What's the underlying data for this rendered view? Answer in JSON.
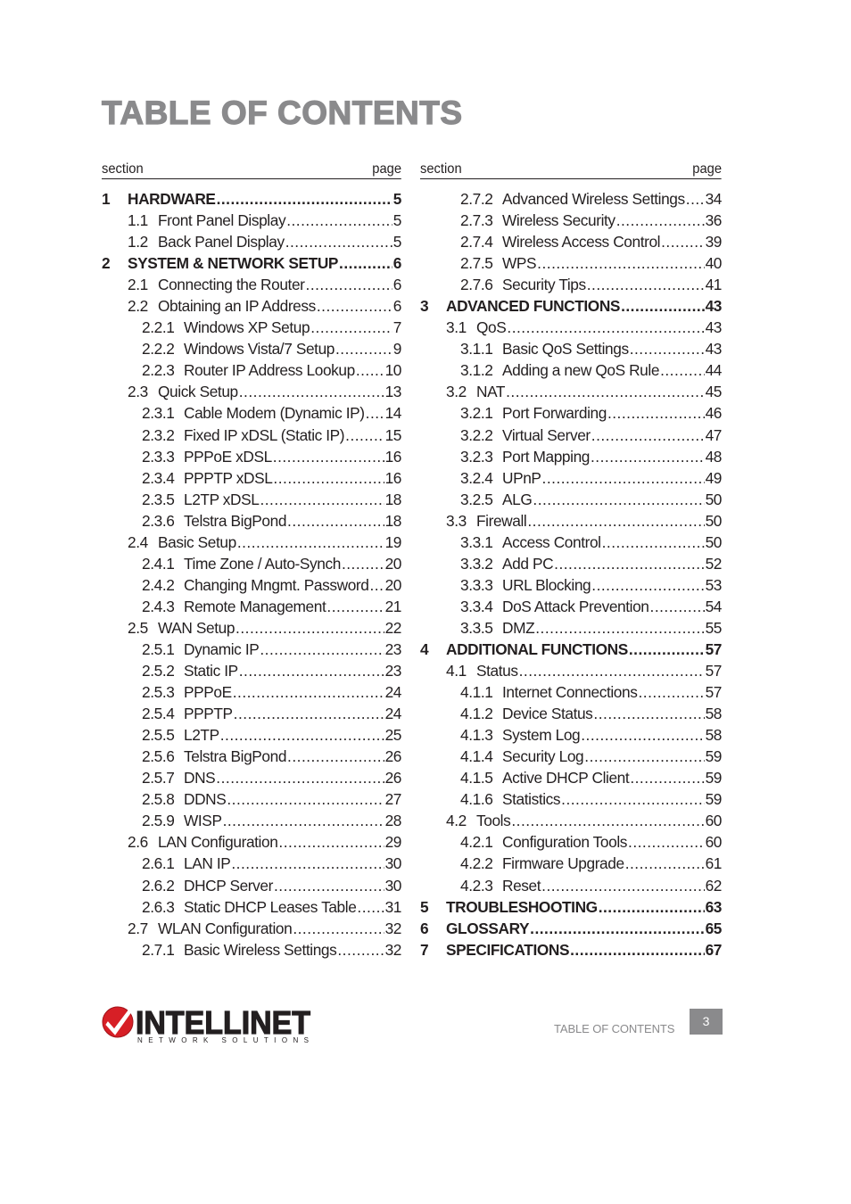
{
  "title": "TABLE OF CONTENTS",
  "columns": [
    {
      "header": {
        "section": "section",
        "page": "page"
      },
      "entries": [
        {
          "level": 1,
          "num": "1",
          "label": "HARDWARE",
          "page": "5"
        },
        {
          "level": 2,
          "num": "1.1",
          "label": "Front Panel Display",
          "page": "5"
        },
        {
          "level": 2,
          "num": "1.2",
          "label": "Back Panel Display",
          "page": "5"
        },
        {
          "level": 1,
          "num": "2",
          "label": "SYSTEM & NETWORK SETUP",
          "page": "6"
        },
        {
          "level": 2,
          "num": "2.1",
          "label": "Connecting the Router",
          "page": "6"
        },
        {
          "level": 2,
          "num": "2.2",
          "label": "Obtaining an IP Address",
          "page": "6"
        },
        {
          "level": 3,
          "num": "2.2.1",
          "label": "Windows XP Setup",
          "page": "7"
        },
        {
          "level": 3,
          "num": "2.2.2",
          "label": "Windows Vista/7 Setup",
          "page": "9"
        },
        {
          "level": 3,
          "num": "2.2.3",
          "label": "Router IP Address Lookup",
          "page": "10"
        },
        {
          "level": 2,
          "num": "2.3",
          "label": "Quick Setup",
          "page": "13"
        },
        {
          "level": 3,
          "num": "2.3.1",
          "label": "Cable Modem (Dynamic IP)",
          "page": "14"
        },
        {
          "level": 3,
          "num": "2.3.2",
          "label": "Fixed IP xDSL (Static IP)",
          "page": "15"
        },
        {
          "level": 3,
          "num": "2.3.3",
          "label": "PPPoE xDSL",
          "page": "16"
        },
        {
          "level": 3,
          "num": "2.3.4",
          "label": "PPPTP xDSL",
          "page": "16"
        },
        {
          "level": 3,
          "num": "2.3.5",
          "label": "L2TP xDSL",
          "page": "18"
        },
        {
          "level": 3,
          "num": "2.3.6",
          "label": "Telstra BigPond",
          "page": "18"
        },
        {
          "level": 2,
          "num": "2.4",
          "label": "Basic Setup",
          "page": "19"
        },
        {
          "level": 3,
          "num": "2.4.1",
          "label": "Time Zone / Auto-Synch",
          "page": "20"
        },
        {
          "level": 3,
          "num": "2.4.2",
          "label": "Changing Mngmt. Password",
          "page": "20"
        },
        {
          "level": 3,
          "num": "2.4.3",
          "label": "Remote Management",
          "page": "21"
        },
        {
          "level": 2,
          "num": "2.5",
          "label": "WAN Setup",
          "page": "22"
        },
        {
          "level": 3,
          "num": "2.5.1",
          "label": "Dynamic IP",
          "page": "23"
        },
        {
          "level": 3,
          "num": "2.5.2",
          "label": "Static IP",
          "page": "23"
        },
        {
          "level": 3,
          "num": "2.5.3",
          "label": "PPPoE",
          "page": "24"
        },
        {
          "level": 3,
          "num": "2.5.4",
          "label": "PPPTP",
          "page": "24"
        },
        {
          "level": 3,
          "num": "2.5.5",
          "label": "L2TP",
          "page": "25"
        },
        {
          "level": 3,
          "num": "2.5.6",
          "label": "Telstra BigPond",
          "page": "26"
        },
        {
          "level": 3,
          "num": "2.5.7",
          "label": "DNS",
          "page": "26"
        },
        {
          "level": 3,
          "num": "2.5.8",
          "label": "DDNS",
          "page": "27"
        },
        {
          "level": 3,
          "num": "2.5.9",
          "label": "WISP",
          "page": "28"
        },
        {
          "level": 2,
          "num": "2.6",
          "label": "LAN Configuration",
          "page": "29"
        },
        {
          "level": 3,
          "num": "2.6.1",
          "label": "LAN IP",
          "page": "30"
        },
        {
          "level": 3,
          "num": "2.6.2",
          "label": "DHCP Server",
          "page": "30"
        },
        {
          "level": 3,
          "num": "2.6.3",
          "label": "Static DHCP Leases Table",
          "page": "31"
        },
        {
          "level": 2,
          "num": "2.7",
          "label": "WLAN Configuration",
          "page": "32"
        },
        {
          "level": 3,
          "num": "2.7.1",
          "label": "Basic Wireless Settings",
          "page": "32"
        }
      ]
    },
    {
      "header": {
        "section": "section",
        "page": "page"
      },
      "entries": [
        {
          "level": 3,
          "num": "2.7.2",
          "label": "Advanced Wireless Settings",
          "page": "34"
        },
        {
          "level": 3,
          "num": "2.7.3",
          "label": "Wireless Security",
          "page": "36"
        },
        {
          "level": 3,
          "num": "2.7.4",
          "label": "Wireless Access Control",
          "page": "39"
        },
        {
          "level": 3,
          "num": "2.7.5",
          "label": "WPS",
          "page": "40"
        },
        {
          "level": 3,
          "num": "2.7.6",
          "label": "Security Tips",
          "page": "41"
        },
        {
          "level": 1,
          "num": "3",
          "label": "ADVANCED FUNCTIONS",
          "page": "43"
        },
        {
          "level": 2,
          "num": "3.1",
          "label": "QoS",
          "page": "43"
        },
        {
          "level": 3,
          "num": "3.1.1",
          "label": "Basic QoS Settings",
          "page": "43"
        },
        {
          "level": 3,
          "num": "3.1.2",
          "label": "Adding a new QoS Rule",
          "page": "44"
        },
        {
          "level": 2,
          "num": "3.2",
          "label": "NAT",
          "page": "45"
        },
        {
          "level": 3,
          "num": "3.2.1",
          "label": "Port Forwarding",
          "page": "46"
        },
        {
          "level": 3,
          "num": "3.2.2",
          "label": "Virtual Server",
          "page": "47"
        },
        {
          "level": 3,
          "num": "3.2.3",
          "label": "Port Mapping",
          "page": "48"
        },
        {
          "level": 3,
          "num": "3.2.4",
          "label": "UPnP",
          "page": "49"
        },
        {
          "level": 3,
          "num": "3.2.5",
          "label": "ALG",
          "page": "50"
        },
        {
          "level": 2,
          "num": "3.3",
          "label": "Firewall",
          "page": "50"
        },
        {
          "level": 3,
          "num": "3.3.1",
          "label": "Access Control",
          "page": "50"
        },
        {
          "level": 3,
          "num": "3.3.2",
          "label": "Add PC",
          "page": "52"
        },
        {
          "level": 3,
          "num": "3.3.3",
          "label": "URL Blocking",
          "page": "53"
        },
        {
          "level": 3,
          "num": "3.3.4",
          "label": "DoS Attack Prevention",
          "page": "54"
        },
        {
          "level": 3,
          "num": "3.3.5",
          "label": "DMZ",
          "page": "55"
        },
        {
          "level": 1,
          "num": "4",
          "label": "ADDITIONAL FUNCTIONS",
          "page": "57"
        },
        {
          "level": 2,
          "num": "4.1",
          "label": "Status",
          "page": "57"
        },
        {
          "level": 3,
          "num": "4.1.1",
          "label": "Internet Connections",
          "page": "57"
        },
        {
          "level": 3,
          "num": "4.1.2",
          "label": "Device Status",
          "page": "58"
        },
        {
          "level": 3,
          "num": "4.1.3",
          "label": "System Log",
          "page": "58"
        },
        {
          "level": 3,
          "num": "4.1.4",
          "label": "Security Log",
          "page": "59"
        },
        {
          "level": 3,
          "num": "4.1.5",
          "label": "Active DHCP Client",
          "page": "59"
        },
        {
          "level": 3,
          "num": "4.1.6",
          "label": "Statistics",
          "page": "59"
        },
        {
          "level": 2,
          "num": "4.2",
          "label": "Tools",
          "page": "60"
        },
        {
          "level": 3,
          "num": "4.2.1",
          "label": "Configuration Tools",
          "page": "60"
        },
        {
          "level": 3,
          "num": "4.2.2",
          "label": "Firmware Upgrade",
          "page": "61"
        },
        {
          "level": 3,
          "num": "4.2.3",
          "label": "Reset",
          "page": "62"
        },
        {
          "level": 1,
          "num": "5",
          "label": "TROUBLESHOOTING",
          "page": "63"
        },
        {
          "level": 1,
          "num": "6",
          "label": "GLOSSARY",
          "page": "65"
        },
        {
          "level": 1,
          "num": "7",
          "label": "SPECIFICATIONS",
          "page": "67"
        }
      ]
    }
  ],
  "footer": {
    "logo": {
      "brand": "INTELLINET",
      "tagline": "NETWORK SOLUTIONS",
      "icon": "checkmark-circle-icon",
      "accent": "#d71f26"
    },
    "label": "TABLE OF CONTENTS",
    "page_number": "3"
  },
  "colors": {
    "title_gray": "#8a8a8c",
    "text": "#231f20",
    "page_box": "#8a8a8c"
  }
}
